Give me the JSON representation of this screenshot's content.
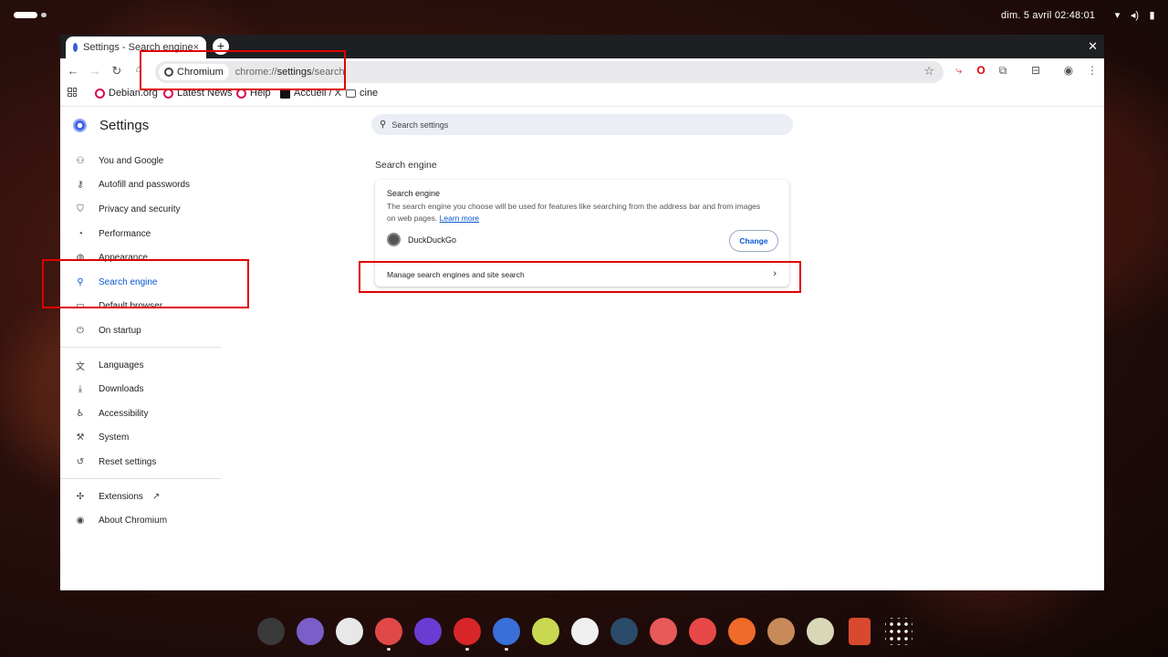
{
  "topbar": {
    "clock": "dim. 5 avril  02:48:01",
    "tray_icons": [
      "wifi-icon",
      "volume-icon",
      "battery-icon"
    ]
  },
  "browser": {
    "tab_title": "Settings - Search engine",
    "tab_close": "×",
    "new_tab": "+",
    "window_close": "✕",
    "chip_label": "Chromium",
    "url_prefix": "chrome://",
    "url_path": "settings",
    "url_suffix": "/search",
    "bookmarks": [
      {
        "label": "Debian.org",
        "color": "#d70a53"
      },
      {
        "label": "Latest News",
        "color": "#d70a53"
      },
      {
        "label": "Help",
        "color": "#d70a53"
      },
      {
        "label": "Accueil / X",
        "color": "#000000"
      },
      {
        "label": "cine",
        "color": "#555555"
      }
    ]
  },
  "settings": {
    "title": "Settings",
    "search_placeholder": "Search settings",
    "nav": [
      {
        "label": "You and Google",
        "icon": "person-icon"
      },
      {
        "label": "Autofill and passwords",
        "icon": "key-icon"
      },
      {
        "label": "Privacy and security",
        "icon": "shield-icon"
      },
      {
        "label": "Performance",
        "icon": "speedometer-icon"
      },
      {
        "label": "Appearance",
        "icon": "palette-icon"
      },
      {
        "label": "Search engine",
        "icon": "search-icon",
        "active": true
      },
      {
        "label": "Default browser",
        "icon": "browser-icon"
      },
      {
        "label": "On startup",
        "icon": "power-icon"
      }
    ],
    "nav_advanced": [
      {
        "label": "Languages",
        "icon": "translate-icon"
      },
      {
        "label": "Downloads",
        "icon": "download-icon"
      },
      {
        "label": "Accessibility",
        "icon": "accessibility-icon"
      },
      {
        "label": "System",
        "icon": "wrench-icon"
      },
      {
        "label": "Reset settings",
        "icon": "reset-icon"
      }
    ],
    "nav_bottom": [
      {
        "label": "Extensions",
        "icon": "puzzle-icon"
      },
      {
        "label": "About Chromium",
        "icon": "chromium-icon"
      }
    ],
    "section_title": "Search engine",
    "card": {
      "title": "Search engine",
      "description": "The search engine you choose will be used for features like searching from the address bar and from images on web pages.",
      "learn_more": "Learn more",
      "engine_name": "DuckDuckGo",
      "change_label": "Change",
      "manage_label": "Manage search engines and site search"
    }
  },
  "accent_colors": {
    "highlight": "#e00000",
    "active_nav": "#0b57d0",
    "active_nav_bg": "#dde4f7"
  },
  "dock": [
    {
      "name": "terminal-icon",
      "color": "#3a3a3a"
    },
    {
      "name": "files-icon",
      "color": "#7a5fc8"
    },
    {
      "name": "media-player-icon",
      "color": "#e8e8e8"
    },
    {
      "name": "mail-icon",
      "color": "#e04848"
    },
    {
      "name": "firefox-icon",
      "color": "#6c3bd1"
    },
    {
      "name": "opera-icon",
      "color": "#d8252a"
    },
    {
      "name": "chromium-icon",
      "color": "#3a6ed8"
    },
    {
      "name": "notes-icon",
      "color": "#c8d850"
    },
    {
      "name": "vlc-icon",
      "color": "#f0f0f0"
    },
    {
      "name": "app-icon",
      "color": "#2c4a6a"
    },
    {
      "name": "pdf-icon",
      "color": "#e85a5a"
    },
    {
      "name": "pdf-tool-icon",
      "color": "#e84848"
    },
    {
      "name": "brush-icon",
      "color": "#f06a2a"
    },
    {
      "name": "gimp-icon",
      "color": "#c88a5a"
    },
    {
      "name": "inkscape-icon",
      "color": "#d8d8b8"
    },
    {
      "name": "trash-icon",
      "color": "#d84a30"
    },
    {
      "name": "app-grid-icon",
      "color": "#ffffff"
    }
  ]
}
